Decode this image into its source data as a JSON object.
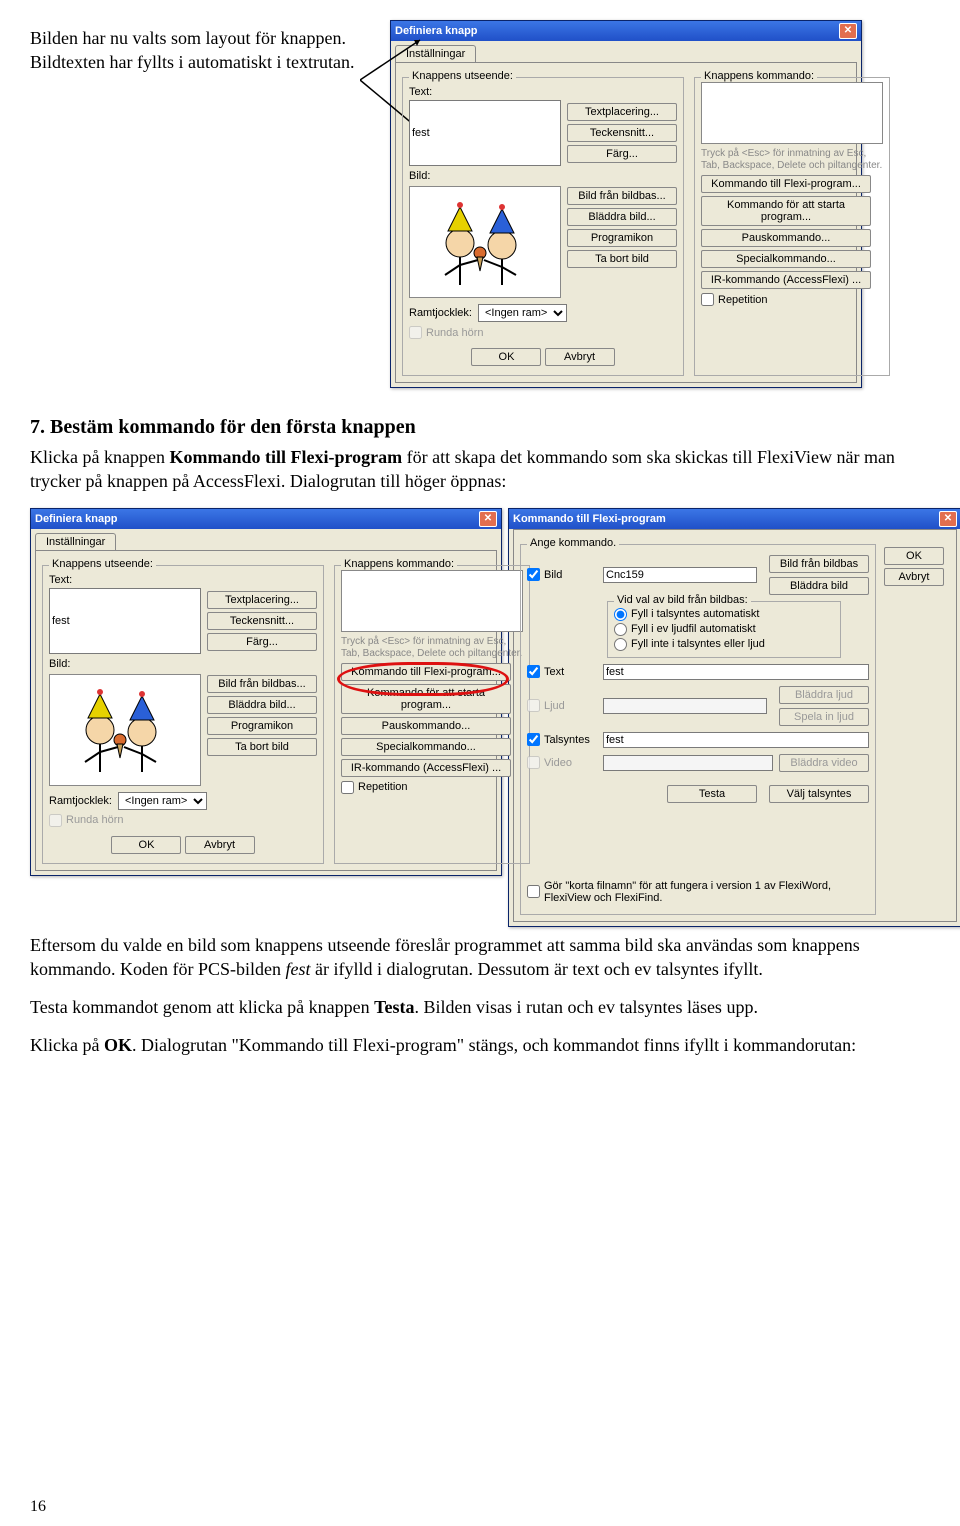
{
  "intro": {
    "p1": "Bilden har nu valts som layout för knappen. Bildtexten har fyllts i automatiskt i textrutan."
  },
  "dialog1": {
    "title": "Definiera knapp",
    "tab": "Inställningar",
    "left_group": "Knappens utseende:",
    "text_label": "Text:",
    "text_value": "fest",
    "bild_label": "Bild:",
    "btn_textplacering": "Textplacering...",
    "btn_teckensnitt": "Teckensnitt...",
    "btn_farg": "Färg...",
    "btn_bildfran": "Bild från bildbas...",
    "btn_bladdra": "Bläddra bild...",
    "btn_programikon": "Programikon",
    "btn_tabort": "Ta bort bild",
    "ramtjocklek": "Ramtjocklek:",
    "ramtjocklek_val": "<Ingen ram>",
    "chk_runda": "Runda hörn",
    "ok": "OK",
    "avbryt": "Avbryt",
    "right_group": "Knappens kommando:",
    "hint": "Tryck på <Esc> för inmatning av Esc, Tab, Backspace, Delete och piltangenter.",
    "btn_cmd_flexi": "Kommando till Flexi-program...",
    "btn_cmd_start": "Kommando för att starta program...",
    "btn_cmd_paus": "Pauskommando...",
    "btn_cmd_special": "Specialkommando...",
    "btn_cmd_ir": "IR-kommando (AccessFlexi) ...",
    "chk_repetition": "Repetition"
  },
  "section2": {
    "heading": "7. Bestäm kommando för den första knappen",
    "body_a": "Klicka på knappen ",
    "body_b": "Kommando till Flexi-program",
    "body_c": " för att skapa det kommando som ska skickas till FlexiView när man trycker på knappen på AccessFlexi. Dialogrutan till höger öppnas:"
  },
  "dialog2": {
    "title": "Kommando till Flexi-program",
    "group": "Ange kommando.",
    "chk_bild": "Bild",
    "bild_val": "Cnc159",
    "btn_bild_bildbas": "Bild från bildbas",
    "btn_bladdra_bild": "Bläddra bild",
    "radio_title": "Vid val av bild från bildbas:",
    "r1": "Fyll i talsyntes automatiskt",
    "r2": "Fyll i ev ljudfil automatiskt",
    "r3": "Fyll inte i talsyntes eller ljud",
    "chk_text": "Text",
    "text_val": "fest",
    "chk_ljud": "Ljud",
    "btn_bladdra_ljud": "Bläddra ljud",
    "btn_spela_ljud": "Spela in ljud",
    "chk_talsyntes": "Talsyntes",
    "talsyntes_val": "fest",
    "chk_video": "Video",
    "btn_bladdra_video": "Bläddra video",
    "btn_testa": "Testa",
    "btn_valj": "Välj talsyntes",
    "chk_filnamn": "Gör \"korta filnamn\" för att fungera i version 1 av FlexiWord, FlexiView och FlexiFind.",
    "ok": "OK",
    "avbryt": "Avbryt"
  },
  "after": {
    "p1a": "Eftersom du valde en bild som knappens utseende föreslår programmet att samma bild ska användas som knappens kommando. Koden för PCS-bilden ",
    "p1b": "fest",
    "p1c": " är ifylld i dialogrutan. Dessutom är text och ev talsyntes ifyllt.",
    "p2a": "Testa kommandot genom att klicka på knappen ",
    "p2b": "Testa",
    "p2c": ". Bilden visas i rutan och ev talsyntes läses upp.",
    "p3a": "Klicka på ",
    "p3b": "OK",
    "p3c": ". Dialogrutan \"Kommando till Flexi-program\" stängs, och kommandot finns ifyllt i kommandorutan:"
  },
  "page_number": "16"
}
